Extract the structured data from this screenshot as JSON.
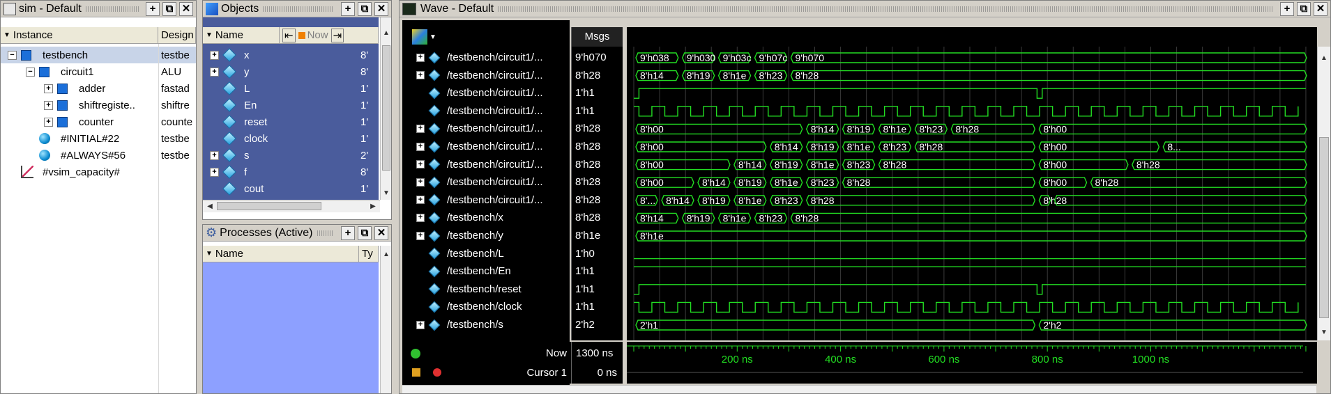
{
  "sim": {
    "title": "sim - Default",
    "headers": [
      "Instance",
      "Design"
    ],
    "rows": [
      {
        "name": "testbench",
        "design": "testbe",
        "icon": "module-icon",
        "level": 0,
        "exp": "-"
      },
      {
        "name": "circuit1",
        "design": "ALU",
        "icon": "module-icon",
        "level": 1,
        "exp": "-"
      },
      {
        "name": "adder",
        "design": "fastad",
        "icon": "module-icon",
        "level": 2,
        "exp": "+"
      },
      {
        "name": "shiftregiste...",
        "design": "shiftre",
        "icon": "module-icon",
        "level": 2,
        "exp": "+"
      },
      {
        "name": "counter",
        "design": "counte",
        "icon": "module-icon",
        "level": 2,
        "exp": "+"
      },
      {
        "name": "#INITIAL#22",
        "design": "testbe",
        "icon": "process-icon",
        "level": 1,
        "exp": ""
      },
      {
        "name": "#ALWAYS#56",
        "design": "testbe",
        "icon": "process-icon",
        "level": 1,
        "exp": ""
      },
      {
        "name": "#vsim_capacity#",
        "design": "",
        "icon": "capacity-icon",
        "level": 0,
        "exp": ""
      }
    ]
  },
  "objects": {
    "title": "Objects",
    "headers": [
      "Name",
      "Now"
    ],
    "rows": [
      {
        "name": "x",
        "val": "8'",
        "exp": "+"
      },
      {
        "name": "y",
        "val": "8'",
        "exp": "+"
      },
      {
        "name": "L",
        "val": "1'",
        "exp": ""
      },
      {
        "name": "En",
        "val": "1'",
        "exp": ""
      },
      {
        "name": "reset",
        "val": "1'",
        "exp": ""
      },
      {
        "name": "clock",
        "val": "1'",
        "exp": ""
      },
      {
        "name": "s",
        "val": "2'",
        "exp": "+"
      },
      {
        "name": "f",
        "val": "8'",
        "exp": "+"
      },
      {
        "name": "cout",
        "val": "1'",
        "exp": ""
      }
    ]
  },
  "processes": {
    "title": "Processes (Active)",
    "headers": [
      "Name",
      "Ty"
    ]
  },
  "wave": {
    "title": "Wave - Default",
    "msgs_header": "Msgs",
    "signals": [
      {
        "name": "/testbench/circuit1/...",
        "msg": "9'h070",
        "exp": "+"
      },
      {
        "name": "/testbench/circuit1/...",
        "msg": "8'h28",
        "exp": "+"
      },
      {
        "name": "/testbench/circuit1/...",
        "msg": "1'h1",
        "exp": ""
      },
      {
        "name": "/testbench/circuit1/...",
        "msg": "1'h1",
        "exp": ""
      },
      {
        "name": "/testbench/circuit1/...",
        "msg": "8'h28",
        "exp": "+"
      },
      {
        "name": "/testbench/circuit1/...",
        "msg": "8'h28",
        "exp": "+"
      },
      {
        "name": "/testbench/circuit1/...",
        "msg": "8'h28",
        "exp": "+"
      },
      {
        "name": "/testbench/circuit1/...",
        "msg": "8'h28",
        "exp": "+"
      },
      {
        "name": "/testbench/circuit1/...",
        "msg": "8'h28",
        "exp": "+"
      },
      {
        "name": "/testbench/x",
        "msg": "8'h28",
        "exp": "+"
      },
      {
        "name": "/testbench/y",
        "msg": "8'h1e",
        "exp": "+"
      },
      {
        "name": "/testbench/L",
        "msg": "1'h0",
        "exp": ""
      },
      {
        "name": "/testbench/En",
        "msg": "1'h1",
        "exp": ""
      },
      {
        "name": "/testbench/reset",
        "msg": "1'h1",
        "exp": ""
      },
      {
        "name": "/testbench/clock",
        "msg": "1'h1",
        "exp": ""
      },
      {
        "name": "/testbench/s",
        "msg": "2'h2",
        "exp": "+"
      }
    ],
    "now_label": "Now",
    "now_value": "1300 ns",
    "cursor_label": "Cursor 1",
    "cursor_value": "0 ns",
    "timeline": [
      "200 ns",
      "400 ns",
      "600 ns",
      "800 ns",
      "1000 ns"
    ],
    "bus_values": [
      [
        "9'h038",
        "9'h030",
        "9'h03c",
        "9'h07c",
        "9'h070"
      ],
      [
        "8'h14",
        "8'h19",
        "8'h1e",
        "8'h23",
        "8'h28"
      ],
      [],
      [],
      [
        "8'h00",
        "8'h14",
        "8'h19",
        "8'h1e",
        "8'h23",
        "8'h28",
        "8'h00"
      ],
      [
        "8'h00",
        "8'h14",
        "8'h19",
        "8'h1e",
        "8'h23",
        "8'h28",
        "8'h00",
        "8..."
      ],
      [
        "8'h00",
        "8'h14",
        "8'h19",
        "8'h1e",
        "8'h23",
        "8'h28",
        "8'h00",
        "8'h28"
      ],
      [
        "8'h00",
        "8'h14",
        "8'h19",
        "8'h1e",
        "8'h23",
        "8'h28",
        "8'h00",
        "8'h28"
      ],
      [
        "8'...",
        "8'h14",
        "8'h19",
        "8'h1e",
        "8'h23",
        "8'h28",
        "8'h28"
      ],
      [
        "8'h14",
        "8'h19",
        "8'h1e",
        "8'h23",
        "8'h28"
      ],
      [
        "8'h1e"
      ],
      [],
      [],
      [],
      [],
      [
        "2'h1",
        "2'h2"
      ]
    ]
  }
}
